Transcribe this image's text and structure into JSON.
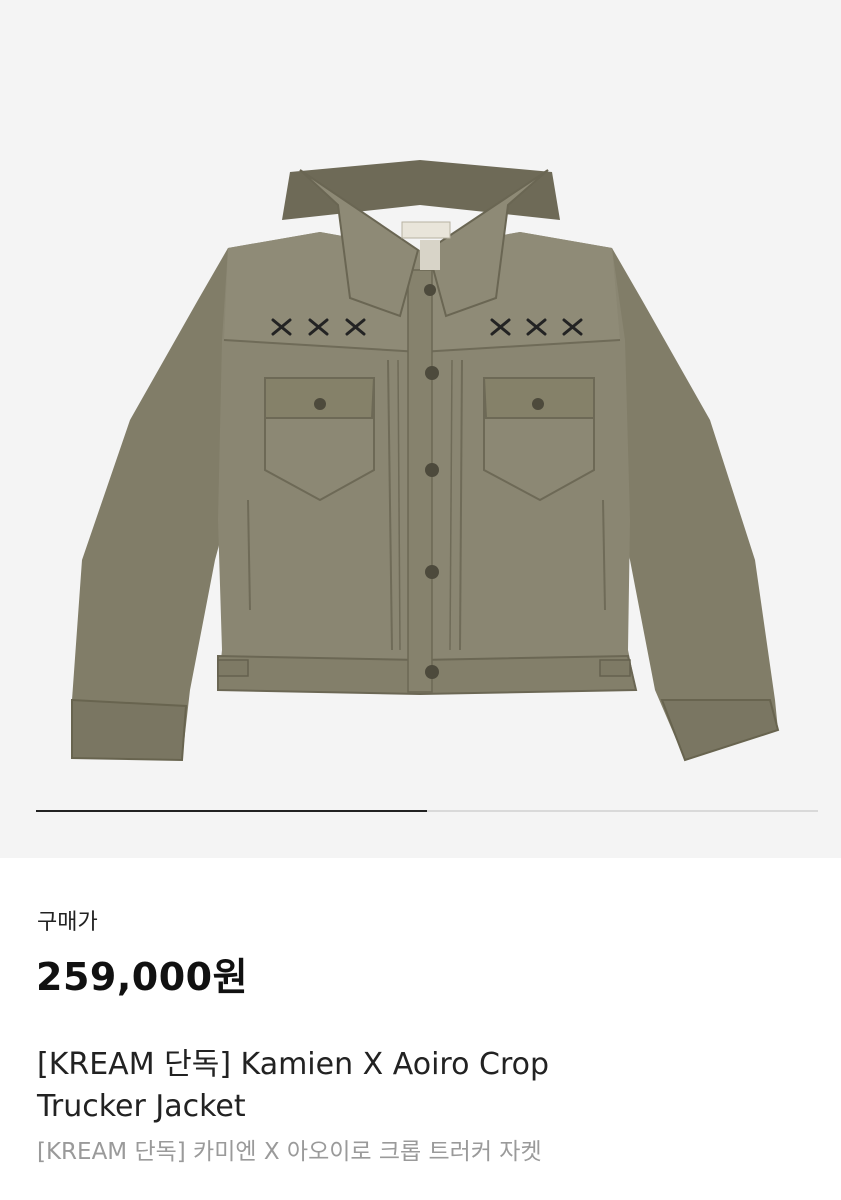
{
  "product": {
    "image_icon": "trucker-jacket-image",
    "jacket_color": "#8a8672",
    "price_label": "구매가",
    "price": "259,000원",
    "title": "[KREAM 단독] Kamien X Aoiro Crop Trucker Jacket",
    "subtitle": "[KREAM 단독] 카미엔 X 아오이로 크롭 트러커 자켓"
  },
  "carousel": {
    "progress": 0.5
  }
}
